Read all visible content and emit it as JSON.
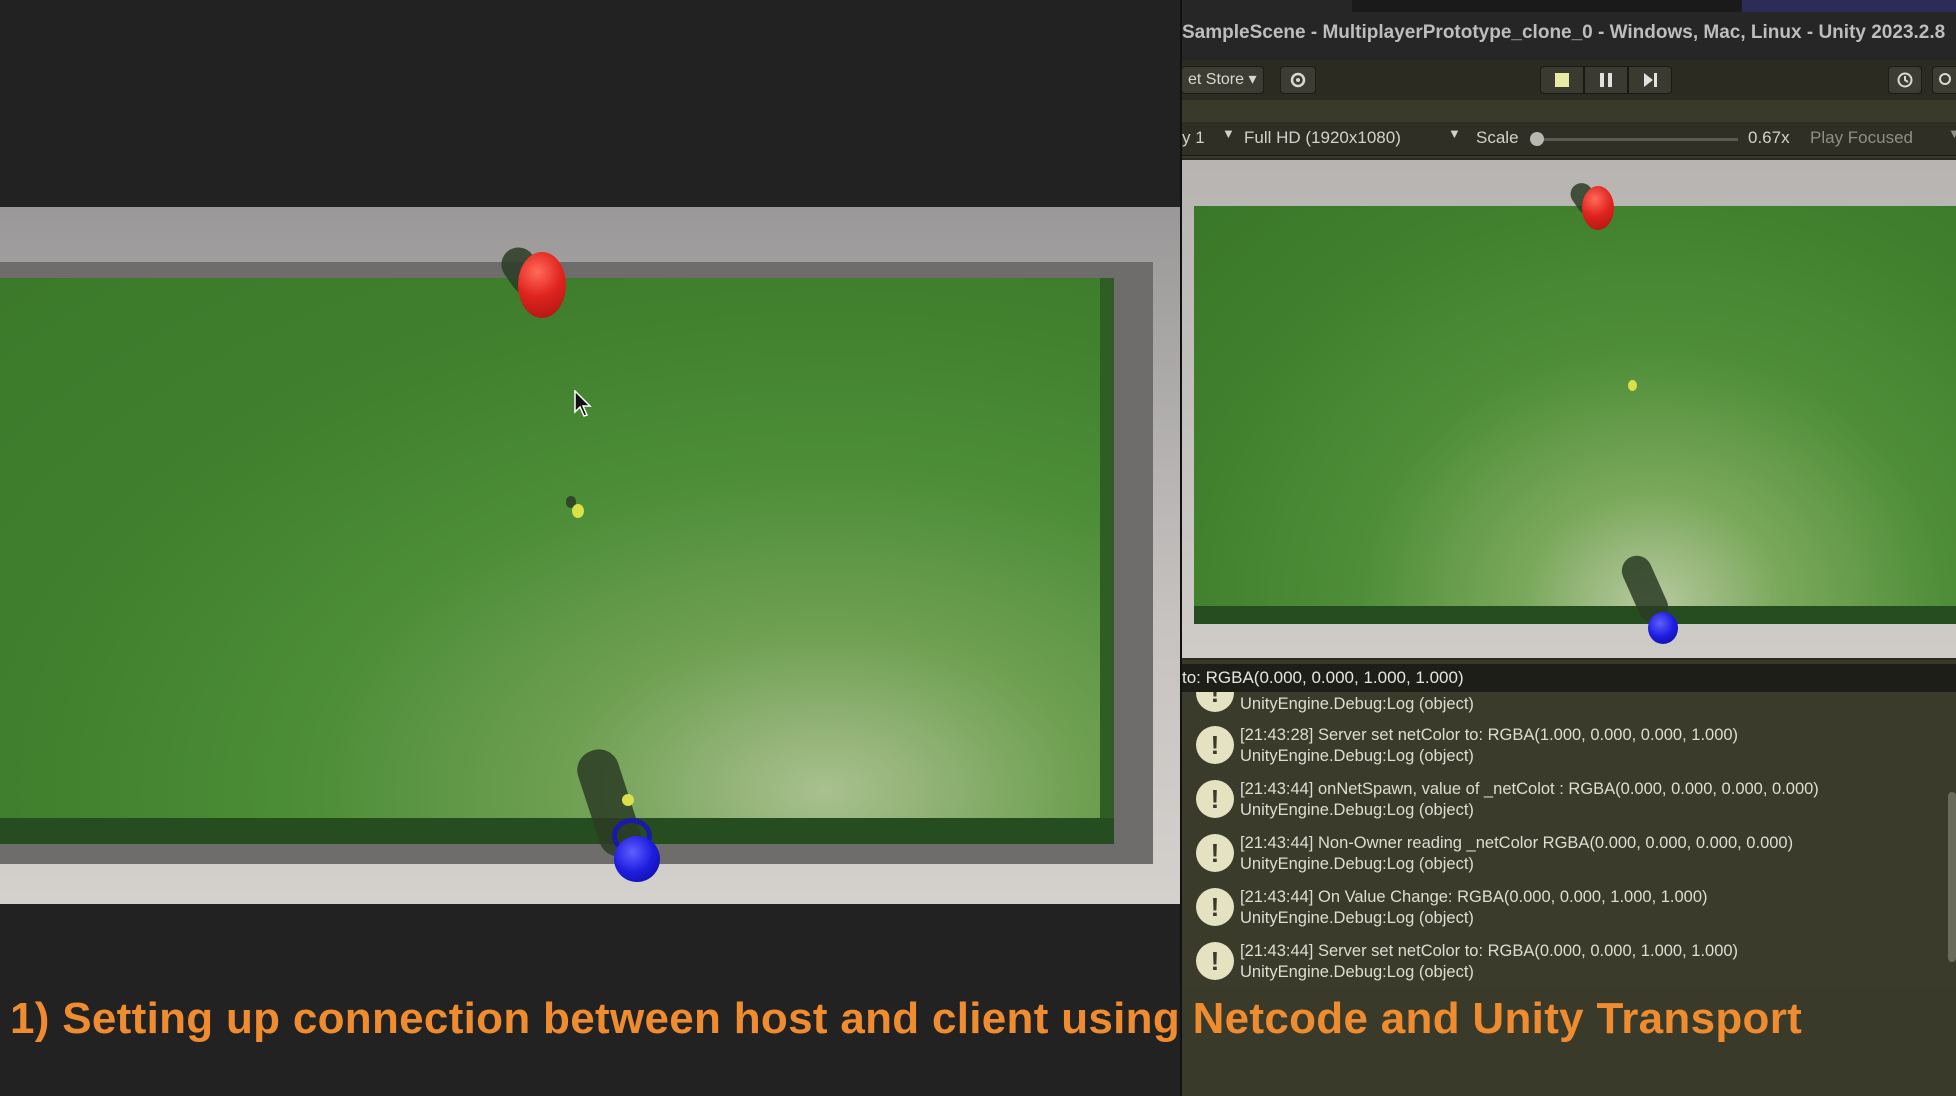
{
  "window": {
    "title": "SampleScene - MultiplayerPrototype_clone_0 - Windows, Mac, Linux - Unity 2023.2.8"
  },
  "toolbar": {
    "asset_store_label": "et Store ▾",
    "settings_icon": "gear-icon",
    "play_controls": [
      "stop-icon",
      "pause-icon",
      "step-icon"
    ],
    "history_icon": "history-icon",
    "search_icon": "search-icon"
  },
  "game_view": {
    "display_label": "y 1",
    "resolution": "Full HD (1920x1080)",
    "scale_label": "Scale",
    "scale_value": "0.67x",
    "play_mode": "Play Focused"
  },
  "console": {
    "status_line": "to: RGBA(0.000, 0.000, 1.000, 1.000)",
    "partial_line": "UnityEngine.Debug:Log (object)",
    "entries": [
      {
        "message": "[21:43:28] Server set netColor to: RGBA(1.000, 0.000, 0.000, 1.000)",
        "source": "UnityEngine.Debug:Log (object)"
      },
      {
        "message": "[21:43:44] onNetSpawn, value of _netColot : RGBA(0.000, 0.000, 0.000, 0.000)",
        "source": "UnityEngine.Debug:Log (object)"
      },
      {
        "message": "[21:43:44] Non-Owner reading _netColor RGBA(0.000, 0.000, 0.000, 0.000)",
        "source": "UnityEngine.Debug:Log (object)"
      },
      {
        "message": "[21:43:44] On Value Change: RGBA(0.000, 0.000, 1.000, 1.000)",
        "source": "UnityEngine.Debug:Log (object)"
      },
      {
        "message": "[21:43:44] Server set netColor to: RGBA(0.000, 0.000, 1.000, 1.000)",
        "source": "UnityEngine.Debug:Log (object)"
      }
    ]
  },
  "caption": {
    "text": "1) Setting up connection between host and client using Netcode and Unity Transport",
    "color": "#f08c30"
  },
  "colors": {
    "red_player": "#e0241e",
    "blue_player": "#1d1de0",
    "field_green": "#4c8d37",
    "ball_yellow": "#d9e04a"
  }
}
